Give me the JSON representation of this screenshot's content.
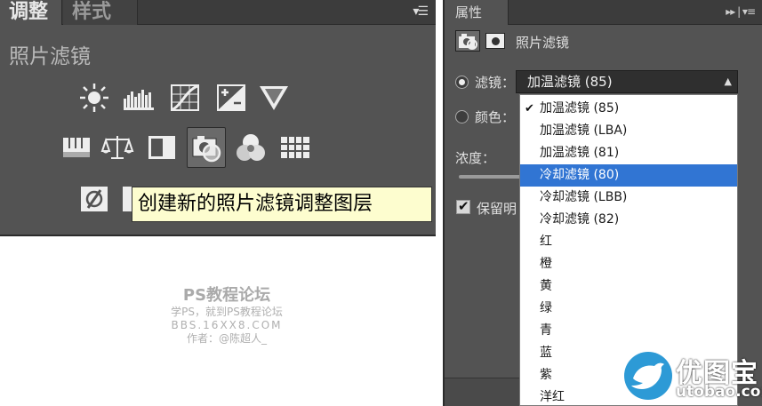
{
  "left_panel": {
    "tabs": [
      "调整",
      "样式"
    ],
    "menu_icon": "panel-menu-icon",
    "title": "照片滤镜",
    "icons_row1": [
      "brightness-contrast-icon",
      "levels-icon",
      "curves-icon",
      "exposure-icon",
      "vibrance-icon"
    ],
    "icons_row2": [
      "hue-saturation-icon",
      "color-balance-icon",
      "black-white-icon",
      "photo-filter-icon",
      "channel-mixer-icon",
      "color-lookup-icon"
    ],
    "icons_row3": [
      "invert-icon",
      "posterize-icon"
    ],
    "tooltip": "创建新的照片滤镜调整图层"
  },
  "watermark": {
    "line1": "PS教程论坛",
    "line2": "学PS，就到PS教程论坛",
    "line3": "BBS.16XX8.COM",
    "line4": "作者：@陈超人_"
  },
  "right_panel": {
    "tab": "属性",
    "controls": "▸▸ | ▾≡",
    "header_label": "照片滤镜",
    "filter_label": "滤镜：",
    "filter_value": "加温滤镜 (85)",
    "color_label": "颜色：",
    "density_label": "浓度：",
    "preserve_label": "保留明",
    "dropdown": {
      "items": [
        "加温滤镜 (85)",
        "加温滤镜 (LBA)",
        "加温滤镜 (81)",
        "冷却滤镜 (80)",
        "冷却滤镜 (LBB)",
        "冷却滤镜 (82)",
        "红",
        "橙",
        "黄",
        "绿",
        "青",
        "蓝",
        "紫",
        "洋红"
      ],
      "checked_index": 0,
      "highlighted_index": 3
    }
  },
  "logo": {
    "title": "优图宝",
    "url": "utobao.com"
  },
  "colors": {
    "panel_bg": "#535353",
    "highlight": "#3175d3",
    "tooltip_bg": "#fdfdcf"
  }
}
